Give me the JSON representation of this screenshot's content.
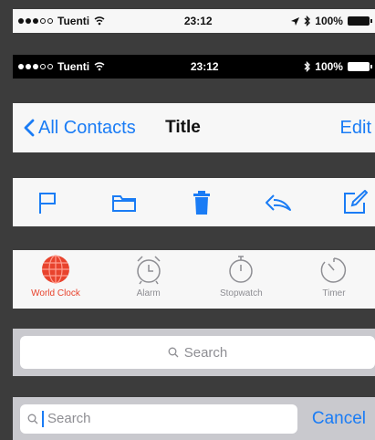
{
  "status_light": {
    "carrier": "Tuenti",
    "time": "23:12",
    "battery": "100%"
  },
  "status_dark": {
    "carrier": "Tuenti",
    "time": "23:12",
    "battery": "100%"
  },
  "navbar": {
    "back_label": "All Contacts",
    "title": "Title",
    "edit_label": "Edit"
  },
  "toolbar": {
    "icons": [
      "flag-icon",
      "folder-icon",
      "trash-icon",
      "reply-icon",
      "compose-icon"
    ]
  },
  "tabbar": {
    "tabs": [
      {
        "label": "World Clock",
        "icon": "globe-icon",
        "active": true
      },
      {
        "label": "Alarm",
        "icon": "alarm-clock-icon",
        "active": false
      },
      {
        "label": "Stopwatch",
        "icon": "stopwatch-icon",
        "active": false
      },
      {
        "label": "Timer",
        "icon": "timer-icon",
        "active": false
      }
    ]
  },
  "search_idle": {
    "placeholder": "Search"
  },
  "search_active": {
    "placeholder": "Search",
    "cancel_label": "Cancel"
  },
  "colors": {
    "accent": "#1a7cf5",
    "active_tab": "#e8432d",
    "inactive_tab": "#8e8e93"
  }
}
